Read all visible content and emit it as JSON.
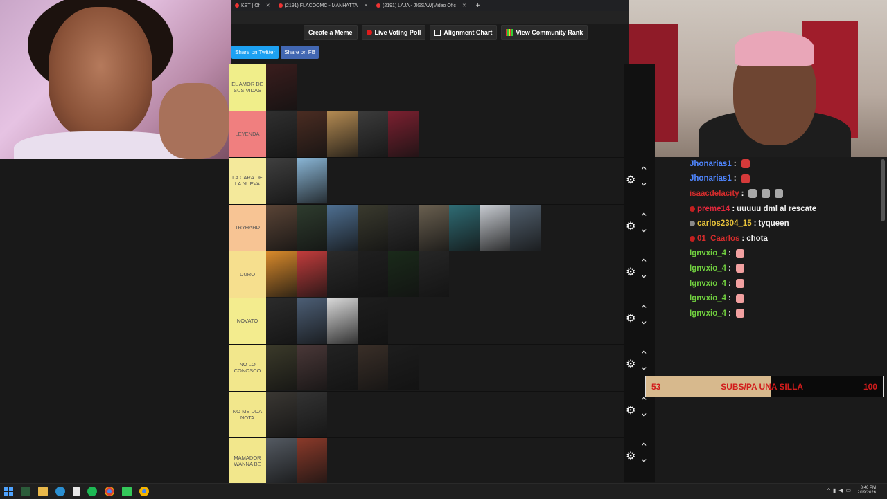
{
  "browser": {
    "tabs": [
      {
        "label": "191) FLACOOMC - MANHATTA",
        "full": "(2191) FLACOOMC - MANHATTA"
      },
      {
        "label": "(2191) LAJA - JIGSAW(Video Ofic"
      }
    ],
    "first_tab_label": "KET | Of",
    "new_tab": "+"
  },
  "toolbar": {
    "create_meme": "Create a Meme",
    "live_voting": "Live Voting Poll",
    "alignment_chart": "Alignment Chart",
    "community_rank": "View Community Rank"
  },
  "share": {
    "twitter": "Share on Twitter",
    "fb": "Share on FB"
  },
  "tiers": [
    {
      "label": "EL AMOR DE SUS VIDAS",
      "color": "#f0ee8a",
      "thumbs": [
        "#3a1d1d"
      ]
    },
    {
      "label": "LEYENDA",
      "color": "#f07f7f",
      "thumbs": [
        "#2f2f2f",
        "#4a2c22",
        "#b38a52",
        "#3b3b3b",
        "#7b2030"
      ]
    },
    {
      "label": "la cara de la nueva",
      "color": "#f4e99b",
      "thumbs": [
        "#3f3f3f",
        "#8ab6d6"
      ]
    },
    {
      "label": "TRYHARD",
      "color": "#f7c494",
      "thumbs": [
        "#5a4436",
        "#2e3c2e",
        "#4e6f91",
        "#3a3a2e",
        "#313131",
        "#6a6050",
        "#2f6c74",
        "#c8ccd2",
        "#52606e"
      ]
    },
    {
      "label": "DURO",
      "color": "#f6df8e",
      "thumbs": [
        "#d98a2b",
        "#c23c3c",
        "#2a2a2a",
        "#1f1f1f",
        "#1a2a1a",
        "#262626"
      ]
    },
    {
      "label": "NOVATO",
      "color": "#f3ec8e",
      "thumbs": [
        "#2b2b2b",
        "#4c5e75",
        "#d9d9d9",
        "#1d1d1d"
      ]
    },
    {
      "label": "NO LO CONOSCO",
      "color": "#f2e78c",
      "thumbs": [
        "#3b3a2a",
        "#4a3838",
        "#222222",
        "#3a2f28",
        "#1d1d1d"
      ]
    },
    {
      "label": "NO ME DDA NOTA",
      "color": "#f2e78c",
      "thumbs": [
        "#3a3733",
        "#333333"
      ]
    },
    {
      "label": "MAMADOR WANNA BE",
      "color": "#f2e78c",
      "thumbs": [
        "#545a62",
        "#8b3a2a"
      ]
    }
  ],
  "chat": [
    {
      "user": "Jhonarias1",
      "color": "#4f86ff",
      "text": "",
      "emotes": [
        "#d63a3a"
      ],
      "badge": ""
    },
    {
      "user": "Jhonarias1",
      "color": "#4f86ff",
      "text": "",
      "emotes": [
        "#d63a3a"
      ],
      "badge": ""
    },
    {
      "user": "isaacdelacity",
      "color": "#d42c2c",
      "text": "",
      "emotes": [
        "#a8a8a8",
        "#a8a8a8",
        "#a8a8a8"
      ],
      "badge": ""
    },
    {
      "user": "preme14",
      "color": "#e0283c",
      "text": "uuuuu dml al rescate",
      "emotes": [],
      "badge": "#c41f1f"
    },
    {
      "user": "carlos2304_15",
      "color": "#e7c23a",
      "text": "tyqueen",
      "emotes": [],
      "badge": "#8a8a8a"
    },
    {
      "user": "01_Caarlos",
      "color": "#d42c2c",
      "text": "chota",
      "emotes": [],
      "badge": "#c41f1f"
    },
    {
      "user": "Ignvxio_4",
      "color": "#71d13f",
      "text": "",
      "emotes": [
        "#f2a0a0"
      ],
      "badge": ""
    },
    {
      "user": "Ignvxio_4",
      "color": "#71d13f",
      "text": "",
      "emotes": [
        "#f2a0a0"
      ],
      "badge": ""
    },
    {
      "user": "Ignvxio_4",
      "color": "#71d13f",
      "text": "",
      "emotes": [
        "#f2a0a0"
      ],
      "badge": ""
    },
    {
      "user": "Ignvxio_4",
      "color": "#71d13f",
      "text": "",
      "emotes": [
        "#f2a0a0"
      ],
      "badge": ""
    },
    {
      "user": "Ignvxio_4",
      "color": "#71d13f",
      "text": "",
      "emotes": [
        "#f2a0a0"
      ],
      "badge": ""
    }
  ],
  "goal": {
    "current": "53",
    "label": "SUBS/PA UNA SILLA",
    "target": "100",
    "progress": 0.53
  },
  "taskbar": {
    "time": "8:46 PM",
    "date": "2/19/2026"
  }
}
